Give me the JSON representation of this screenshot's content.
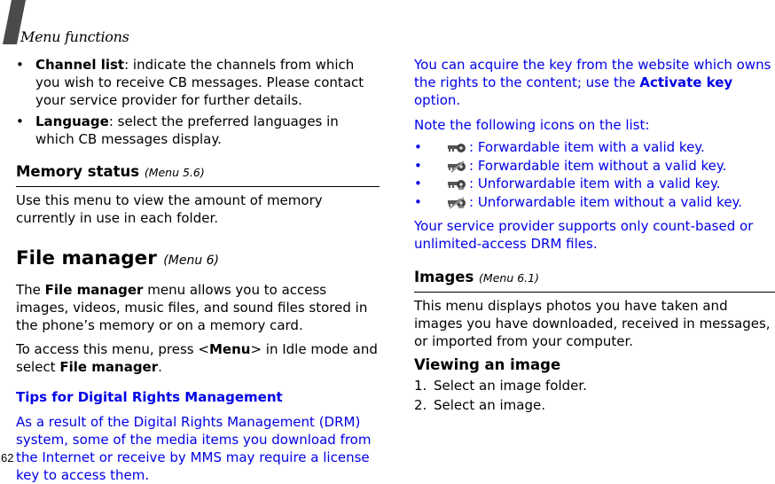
{
  "header": {
    "title": "Menu functions"
  },
  "page_number": "62",
  "left": {
    "bullets": [
      {
        "term": "Channel list",
        "text": ": indicate the channels from which you wish to receive CB messages. Please contact your service provider for further details."
      },
      {
        "term": "Language",
        "text": ": select the preferred languages in which CB messages display."
      }
    ],
    "memory_status": {
      "title": "Memory status",
      "menu": "(Menu 5.6)",
      "body": "Use this menu to view the amount of memory currently in use in each folder."
    },
    "file_manager": {
      "title": "File manager",
      "menu": "(Menu 6)",
      "intro_pre": "The ",
      "intro_bold": "File manager",
      "intro_post": " menu allows you to access images, videos, music files, and sound files stored in the phone’s memory or on a memory card.",
      "access_pre": "To access this menu, press <",
      "access_key": "Menu",
      "access_mid": "> in Idle mode and select ",
      "access_bold": "File manager",
      "access_post": "."
    },
    "drm_tips": {
      "title": "Tips for Digital Rights Management",
      "body": "As a result of the Digital Rights Management (DRM) system, some of the media items you download from the Internet or receive by MMS may require a license key to access them."
    }
  },
  "right": {
    "key_pre": "You can acquire the key from the website which owns the rights to the content; use the ",
    "key_bold": "Activate key",
    "key_post": " option.",
    "icons_intro": "Note the following icons on the list:",
    "icon_items": [
      {
        "icon": "key-forwardable-valid-icon",
        "text": ": Forwardable item with a valid key."
      },
      {
        "icon": "key-forwardable-invalid-icon",
        "text": ": Forwardable item without a valid key."
      },
      {
        "icon": "key-unforwardable-valid-icon",
        "text": ": Unforwardable item with a valid key."
      },
      {
        "icon": "key-unforwardable-invalid-icon",
        "text": ": Unforwardable item without a valid key."
      }
    ],
    "provider_note": "Your service provider supports only count-based or unlimited-access DRM files.",
    "images": {
      "title": "Images",
      "menu": "(Menu 6.1)",
      "body": "This menu displays photos you have taken and images you have downloaded, received in messages, or imported from your computer."
    },
    "viewing": {
      "title": "Viewing an image",
      "steps": [
        {
          "n": "1.",
          "text": "Select an image folder."
        },
        {
          "n": "2.",
          "text": "Select an image."
        }
      ]
    }
  },
  "colors": {
    "blue_text": "#0000e6",
    "slash": "#4a4a4a"
  }
}
